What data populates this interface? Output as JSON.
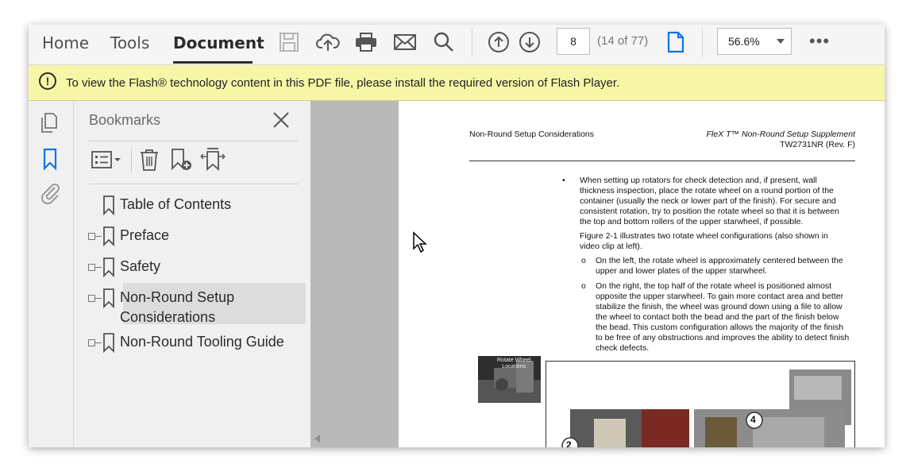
{
  "toolbar": {
    "menu": [
      "Home",
      "Tools",
      "Document"
    ],
    "active_menu": "Document",
    "icons": [
      "save-icon",
      "cloud-upload-icon",
      "print-icon",
      "email-icon",
      "search-icon",
      "previous-page-icon",
      "next-page-icon",
      "page-view-icon",
      "more-icon"
    ],
    "page_number": "8",
    "page_count": "(14 of 77)",
    "zoom": "56.6%",
    "more": "•••"
  },
  "notice": {
    "icon": "!",
    "text": "To view the Flash® technology content in this PDF file, please install the required version of Flash Player."
  },
  "rail": {
    "icons": [
      "copy-pages-icon",
      "bookmark-icon",
      "attachment-icon"
    ]
  },
  "bookmarks": {
    "title": "Bookmarks",
    "tools": [
      "options-icon",
      "delete-icon",
      "new-bookmark-icon",
      "expand-bookmark-icon"
    ],
    "items": [
      {
        "label": "Table of Contents",
        "expandable": false,
        "selected": false
      },
      {
        "label": "Preface",
        "expandable": true,
        "selected": false
      },
      {
        "label": "Safety",
        "expandable": true,
        "selected": false
      },
      {
        "label": "Non-Round Setup",
        "label2": "Considerations",
        "expandable": true,
        "selected": true
      },
      {
        "label": "Non-Round Tooling Guide",
        "expandable": true,
        "selected": false
      }
    ]
  },
  "document": {
    "header_left": "Non-Round Setup Considerations",
    "header_right_1": "FleX T™ Non-Round Setup Supplement",
    "header_right_2": "TW2731NR (Rev. F)",
    "bullet": "•",
    "para1": [
      "When setting up rotators for check detection and, if present, wall",
      "thickness inspection, place the rotate wheel on a round portion of the",
      "container (usually the neck or lower part of the finish). For secure and",
      "consistent rotation, try to position the rotate wheel so that it is between",
      "the top and bottom rollers of the upper starwheel, if possible."
    ],
    "para2": [
      "Figure 2-1 illustrates two rotate wheel configurations (also shown in",
      "video clip at left)."
    ],
    "sub_bullet": "o",
    "sub1": [
      "On the left, the rotate wheel is approximately centered between the",
      "upper and lower plates of the upper starwheel."
    ],
    "sub2": [
      "On the right, the top half of the rotate wheel is positioned almost",
      "opposite the upper starwheel. To gain more contact area and better",
      "stabilize the finish, the wheel was ground down using a file to allow",
      "the wheel to contact both the bead and the part of the finish below",
      "the bead. This custom configuration allows the majority of the finish",
      "to be free of any obstructions and improves the ability to detect finish",
      "check defects."
    ],
    "video_caption": [
      "Rotate Wheel",
      "Locations"
    ],
    "figure_labels": [
      "2",
      "4"
    ]
  }
}
